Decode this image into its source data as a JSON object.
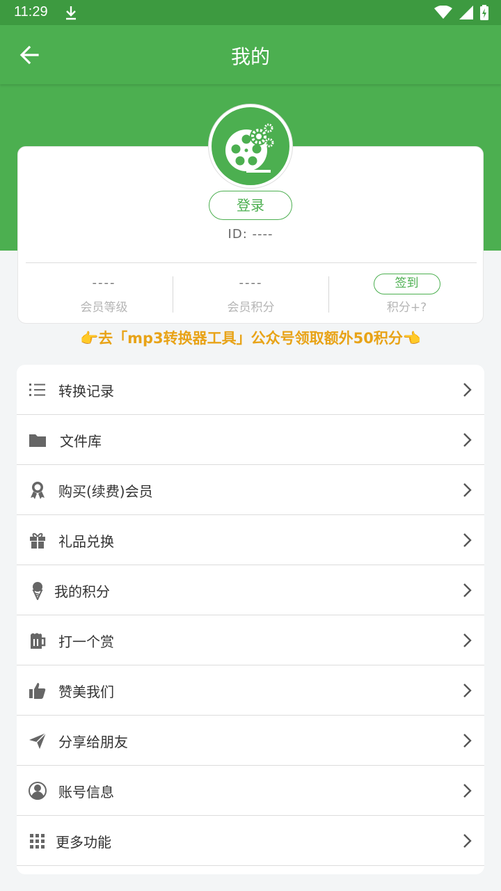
{
  "status_bar": {
    "time": "11:29"
  },
  "header": {
    "title": "我的"
  },
  "profile": {
    "login_label": "登录",
    "id_text": "ID: ----",
    "stats": [
      {
        "value": "----",
        "label": "会员等级"
      },
      {
        "value": "----",
        "label": "会员积分"
      },
      {
        "button": "签到",
        "label": "积分+?"
      }
    ]
  },
  "promo_text": "👉去「mp3转换器工具」公众号领取额外50积分👈",
  "menu": {
    "items": [
      {
        "label": "转换记录",
        "icon": "list-icon"
      },
      {
        "label": "文件库",
        "icon": "folder-icon"
      },
      {
        "label": "购买(续费)会员",
        "icon": "award-ribbon-icon"
      },
      {
        "label": "礼品兑换",
        "icon": "gift-icon"
      },
      {
        "label": "我的积分",
        "icon": "ice-cream-icon"
      },
      {
        "label": "打一个赏",
        "icon": "beer-mug-icon"
      },
      {
        "label": "赞美我们",
        "icon": "thumbs-up-icon"
      },
      {
        "label": "分享给朋友",
        "icon": "paper-plane-icon"
      },
      {
        "label": "账号信息",
        "icon": "user-circle-icon"
      },
      {
        "label": "更多功能",
        "icon": "grid-icon"
      }
    ]
  },
  "colors": {
    "primary": "#4caf50",
    "status_bar": "#3d9a40",
    "promo": "#e8a317"
  }
}
